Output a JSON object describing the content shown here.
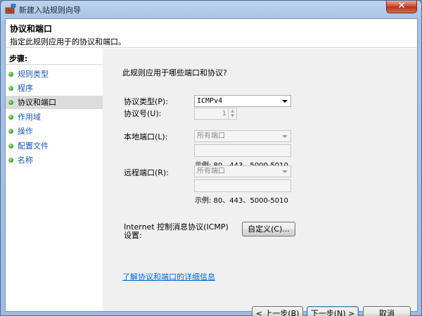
{
  "window": {
    "title": "新建入站规则向导",
    "close_glyph": "✕"
  },
  "header": {
    "title": "协议和端口",
    "subtitle": "指定此规则应用于的协议和端口。"
  },
  "steps": {
    "title": "步骤:",
    "items": [
      {
        "label": "规则类型",
        "active": false
      },
      {
        "label": "程序",
        "active": false
      },
      {
        "label": "协议和端口",
        "active": true
      },
      {
        "label": "作用域",
        "active": false
      },
      {
        "label": "操作",
        "active": false
      },
      {
        "label": "配置文件",
        "active": false
      },
      {
        "label": "名称",
        "active": false
      }
    ]
  },
  "main": {
    "question": "此规则应用于哪些端口和协议?",
    "protocol_type_label": "协议类型(P):",
    "protocol_type_value": "ICMPv4",
    "protocol_number_label": "协议号(U):",
    "protocol_number_value": "1",
    "local_port_label": "本地端口(L):",
    "local_port_value": "所有端口",
    "local_port_example": "示例: 80、443、5000-5010",
    "remote_port_label": "远程端口(R):",
    "remote_port_value": "所有端口",
    "remote_port_example": "示例: 80、443、5000-5010",
    "icmp_label": "Internet 控制消息协议(ICMP)设置:",
    "customize_button": "自定义(C)...",
    "learn_more_link": "了解协议和端口的详细信息"
  },
  "footer": {
    "back_button": "< 上一步(B)",
    "next_button": "下一步(N) >",
    "cancel_button": "取消"
  },
  "icons": {
    "app": "firewall-wizard-icon",
    "step": "green-dot-icon"
  }
}
